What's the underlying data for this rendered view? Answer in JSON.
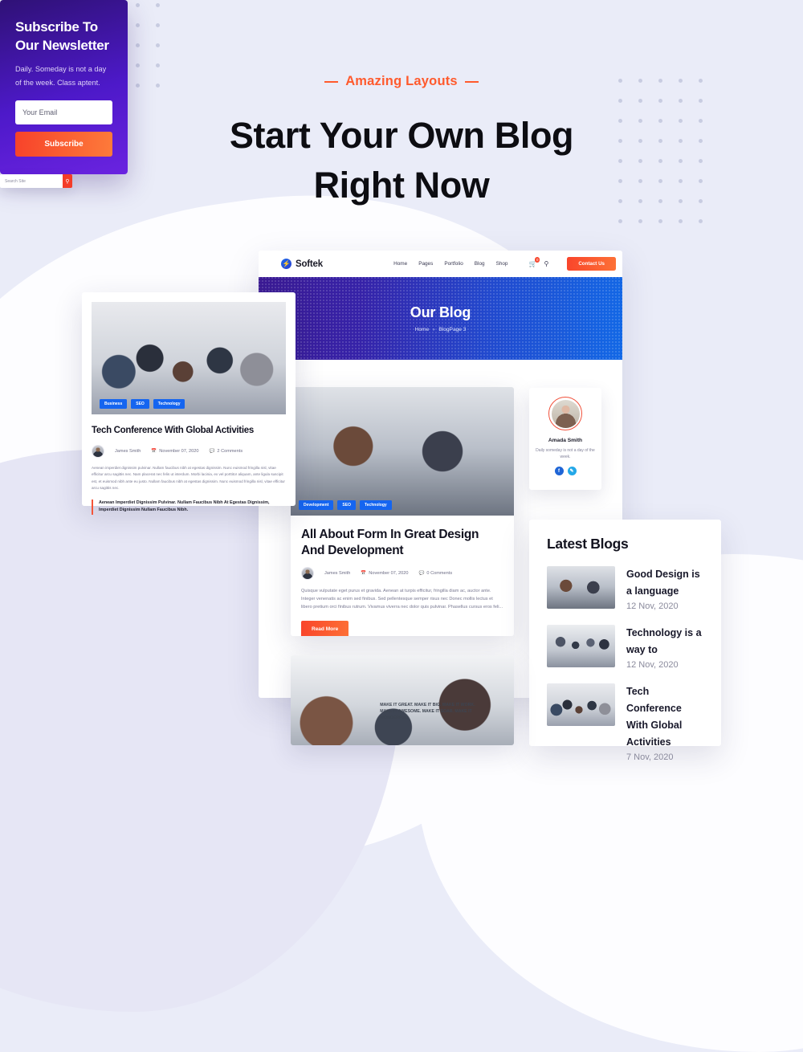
{
  "theme": {
    "page_bg": "#eaecf8",
    "accent_orange": "#ff5a2d",
    "accent_blue": "#1565f0",
    "purple": "#4d19c9",
    "dot_color": "#c8cce1"
  },
  "hero": {
    "eyebrow": "Amazing Layouts",
    "title_line1": "Start Your Own Blog",
    "title_line2": "Right Now"
  },
  "browser": {
    "logo_text": "Softek",
    "logo_icon": "lightning-bolt-icon",
    "menu": [
      {
        "label": "Home",
        "caret": true
      },
      {
        "label": "Pages",
        "caret": true
      },
      {
        "label": "Portfolio",
        "caret": false
      },
      {
        "label": "Blog",
        "caret": true
      },
      {
        "label": "Shop",
        "caret": true
      }
    ],
    "cart_icon": "shopping-cart-icon",
    "cart_badge": "0",
    "search_icon": "search-icon",
    "contact_button": "Contact Us",
    "hero_title": "Our Blog",
    "breadcrumb_home": "Home",
    "breadcrumb_separator": "›",
    "breadcrumb_current": "BlogPage 3"
  },
  "center_post": {
    "tags": [
      "Development",
      "SEO",
      "Technology"
    ],
    "title": "All About Form In Great Design And Development",
    "author": "James Smith",
    "date": "November 07, 2020",
    "comments": "0 Comments",
    "calendar_icon": "calendar-icon",
    "comment_icon": "comment-icon",
    "excerpt": "Quisque vulputate eget purus et gravida. Aenean at turpis efficitur, fringilla diam ac, auctor ante. Integer venenatis ac enim sed finibus. Sed pellentesque semper risus nec Donec mollis lectus et libero pretium orci finibus rutrum. Vivamus viverra nec dolor quis pulvinar. Phasellus cursus eros feli...",
    "read_more": "Read More"
  },
  "left_card": {
    "tags": [
      "Business",
      "SEO",
      "Technology"
    ],
    "title": "Tech Conference With Global Activities",
    "author": "James Smith",
    "date": "November 07, 2020",
    "comments": "2 Comments",
    "excerpt": "Aenean imperdiet dignissim pulvinar. Nullam faucibus nibh at egestas dignissim. Nunc euismod fringilla nisl, vitae efficitur arcu sagittis nec. Nam placerat nec felis ut interdum. Morbi lacinia, ex vel porttitor aliquam, ante ligula suscipit est, et euismod nibh ante eu justo. Nullam faucibus nibh at egestas dignissim. Nunc euismod fringilla nisl, vitae efficitur arcu sagittis nec.",
    "quote": "Aenean Imperdiet Dignissim Pulvinar. Nullam Faucibus Nibh At Egestas Dignissim, Imperdiet Dignissim Nullam Faucibus Nibh."
  },
  "newsletter": {
    "title_line1": "Subscribe To",
    "title_line2": "Our Newsletter",
    "description": "Daily. Someday is not a day of the week. Class aptent.",
    "email_placeholder": "Your Email",
    "email_value": "",
    "button_label": "Subscribe"
  },
  "author_widget": {
    "avatar_icon": "author-avatar",
    "name": "Amada Smith",
    "description": "Daily someday is not a day of the week.",
    "social": [
      {
        "name": "facebook-icon",
        "glyph": "f"
      },
      {
        "name": "twitter-icon",
        "glyph": "ᵛ"
      }
    ]
  },
  "search_widget": {
    "placeholder": "Search Site",
    "value": "",
    "icon": "search-icon"
  },
  "latest_blogs": {
    "heading": "Latest Blogs",
    "items": [
      {
        "title": "Good Design is a language",
        "date": "12 Nov, 2020",
        "thumb": "office-desk-photo"
      },
      {
        "title": "Technology is a way to",
        "date": "12 Nov, 2020",
        "thumb": "meeting-room-photo"
      },
      {
        "title": "Tech Conference With Global Activities",
        "date": "7 Nov, 2020",
        "thumb": "team-handshake-photo"
      }
    ]
  },
  "bottom_strip": {
    "wall_text": "MAKE IT GREAT. MAKE IT BIG. MAKE IT WORK. MAKE IT AWESOME. MAKE IT SOAR. MAKE IT WONDERFUL."
  }
}
